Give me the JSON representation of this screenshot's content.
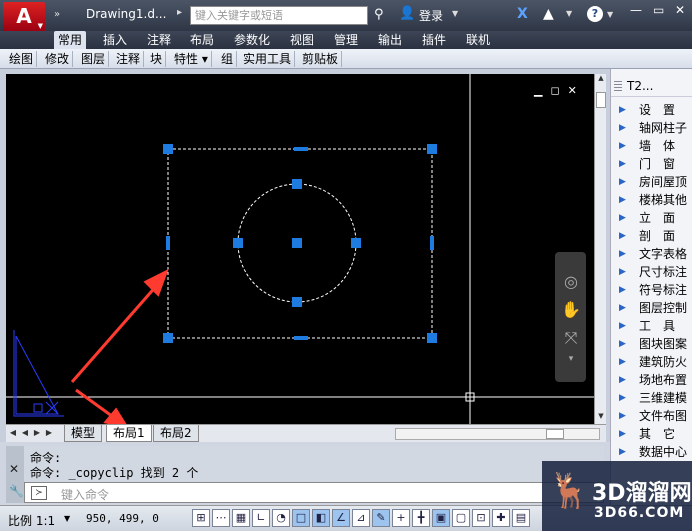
{
  "app": {
    "logo": "A",
    "qat_more": "»",
    "doc_title": "Drawing1.d...",
    "title_more": "▸",
    "search_placeholder": "键入关键字或短语",
    "login": "登录"
  },
  "ribbon": {
    "tabs": [
      "常用",
      "插入",
      "注释",
      "布局",
      "参数化",
      "视图",
      "管理",
      "输出",
      "插件",
      "联机"
    ],
    "active_tab": 0,
    "panels": [
      "绘图",
      "修改",
      "图层",
      "注释",
      "块",
      "特性 ▾",
      "组",
      "实用工具",
      "剪贴板"
    ]
  },
  "viewport": {
    "controls": [
      "▁",
      "◻",
      "✕"
    ],
    "background": "#000000",
    "grip_color": "#1e7be0",
    "arrow_color": "#ff3b30"
  },
  "layout_tabs": [
    "模型",
    "布局1",
    "布局2"
  ],
  "layout_active": 1,
  "command": {
    "line1": "命令:",
    "line2": "命令: _copyclip 找到 2 个",
    "placeholder": "键入命令"
  },
  "status": {
    "scale": "比例 1:1",
    "coords": "950, 499, 0"
  },
  "side_panel": {
    "title": "T2...",
    "items": [
      "设　置",
      "轴网柱子",
      "墙　体",
      "门　窗",
      "房间屋顶",
      "楼梯其他",
      "立　面",
      "剖　面",
      "文字表格",
      "尺寸标注",
      "符号标注",
      "图层控制",
      "工　具",
      "图块图案",
      "建筑防火",
      "场地布置",
      "三维建模",
      "文件布图",
      "其　它",
      "数据中心"
    ]
  },
  "watermark": {
    "brand": "3D溜溜网",
    "url": "3D66.COM"
  }
}
